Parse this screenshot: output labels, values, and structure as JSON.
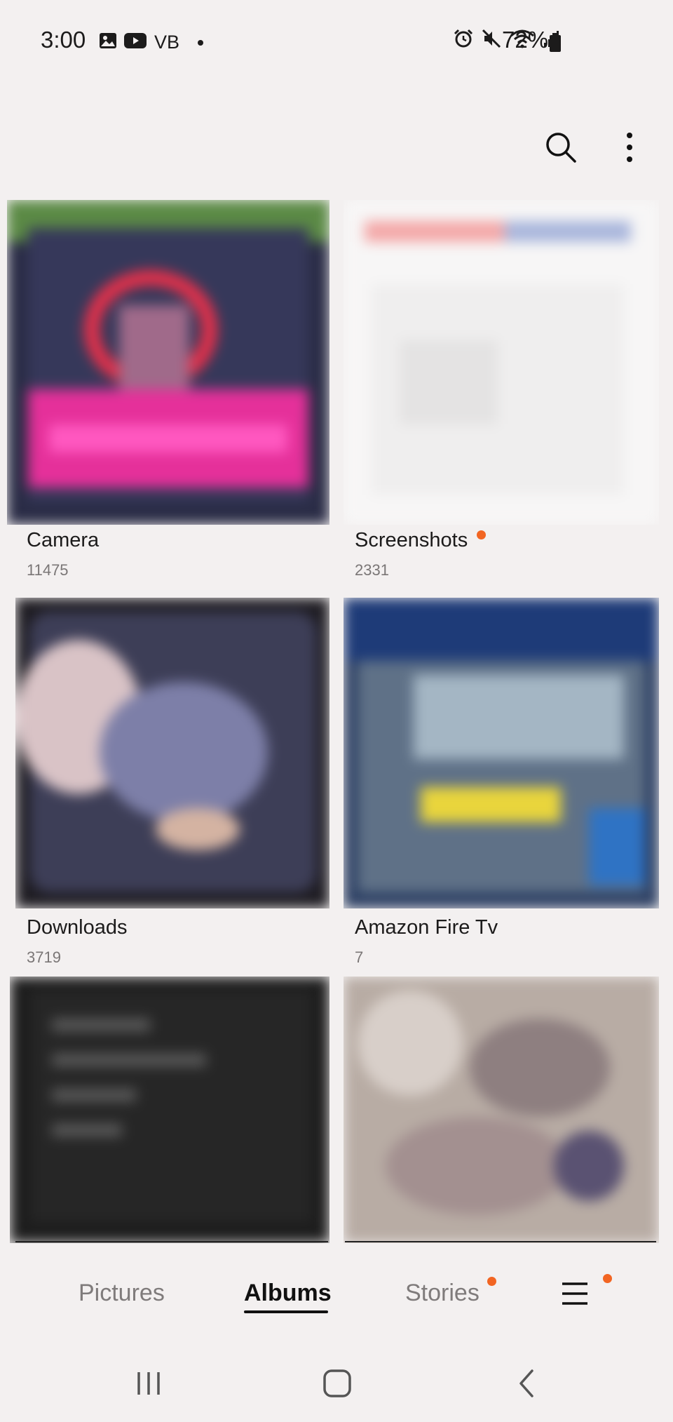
{
  "status_bar": {
    "time": "3:00",
    "carrier": "VB",
    "battery": "72%",
    "left_icons": [
      "gallery-notification-icon",
      "youtube-notification-icon"
    ],
    "right_icons": [
      "alarm-icon",
      "mute-icon",
      "wifi-icon",
      "signal-icon",
      "battery-icon"
    ]
  },
  "header": {
    "actions": [
      "search-icon",
      "more-options-icon"
    ]
  },
  "albums": [
    {
      "name": "Camera",
      "count": "11475",
      "new_badge": false
    },
    {
      "name": "Screenshots",
      "count": "2331",
      "new_badge": true
    },
    {
      "name": "Downloads",
      "count": "3719",
      "new_badge": false
    },
    {
      "name": "Amazon Fire Tv",
      "count": "7",
      "new_badge": false
    },
    {
      "name": "",
      "count": "",
      "new_badge": false
    },
    {
      "name": "",
      "count": "",
      "new_badge": false
    }
  ],
  "tabs": [
    {
      "label": "Pictures",
      "active": false,
      "badge": false
    },
    {
      "label": "Albums",
      "active": true,
      "badge": false
    },
    {
      "label": "Stories",
      "active": false,
      "badge": true
    },
    {
      "label": "",
      "icon": "menu-icon",
      "active": false,
      "badge": true
    }
  ],
  "colors": {
    "background": "#f3f0f0",
    "badge": "#f26522",
    "text_primary": "#1c1b1b",
    "text_secondary": "#7a7676"
  }
}
